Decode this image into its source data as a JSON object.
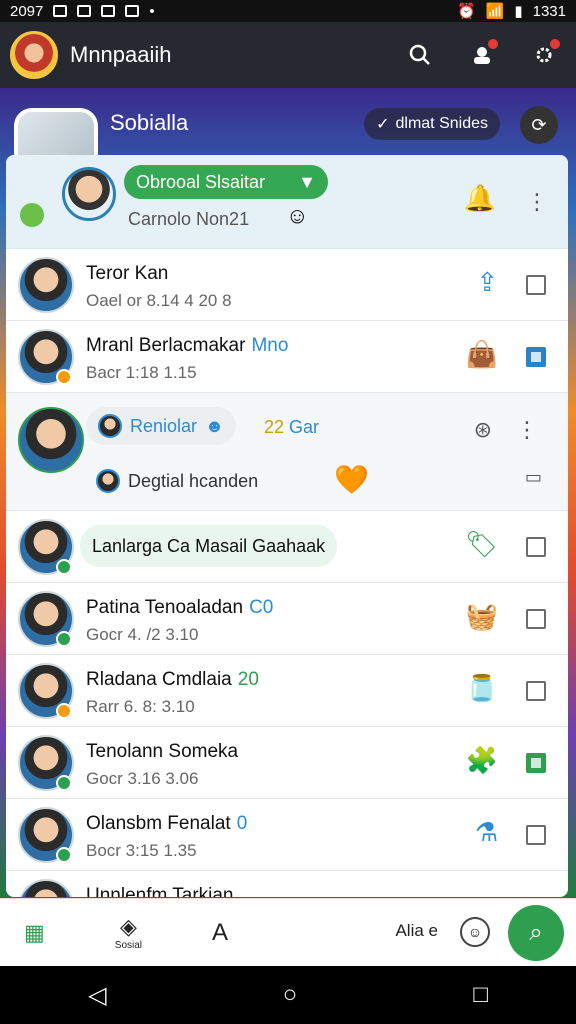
{
  "status_bar": {
    "time_left": "2097",
    "time_right": "1331"
  },
  "app_bar": {
    "title": "Mnnpaaiih"
  },
  "hero": {
    "title": "Sobialla",
    "chip_label": "dlmat Snides"
  },
  "card_header": {
    "dropdown_label": "Obrooal Slsaitar",
    "subtitle": "Carnolo Non21"
  },
  "rows": [
    {
      "name": "Teror Kan",
      "sub": "Oael or 8.14 4 20 8",
      "status_color": "",
      "checkbox": "empty",
      "icon": "share-icon"
    },
    {
      "name": "Mranl Berlacmakar",
      "tag": "Mno",
      "sub": "Bacr 1:18   1.15",
      "status_color": "#f39c12",
      "checkbox": "filled",
      "icon": "bag-icon"
    },
    {
      "name": "Lanlarga Ca Masail Gaahaak",
      "status_color": "#2e9e4f",
      "checkbox": "empty",
      "icon": "tag-icon"
    },
    {
      "name": "Patina Tenoaladan",
      "tag": "C0",
      "sub": "Gocr 4. /2   3.10",
      "status_color": "#2e9e4f",
      "checkbox": "empty",
      "icon": "basket-icon"
    },
    {
      "name": "Rladana Cmdlaia",
      "tag": "20",
      "sub": "Rarr 6. 8:   3.10",
      "status_color": "#f39c12",
      "checkbox": "empty",
      "icon": "jar-icon"
    },
    {
      "name": "Tenolann Someka",
      "sub": "Gocr 3.16   3.06",
      "status_color": "#2e9e4f",
      "checkbox": "filled",
      "icon": "puzzle-icon"
    },
    {
      "name": "Olansbm Fenalat",
      "tag": "0",
      "sub": "Bocr 3:15   1.35",
      "status_color": "#2e9e4f",
      "checkbox": "empty",
      "icon": "flask-icon"
    },
    {
      "name": "Unnlenfm Tarkian",
      "status_color": "",
      "checkbox": "empty",
      "icon": ""
    }
  ],
  "tall_row": {
    "bubble_label": "Reniolar",
    "tag_text": "Gar",
    "line2": "Degtial hcanden"
  },
  "bottom_bar": {
    "item1_label": "Sosial",
    "text_label": "Alia e"
  }
}
